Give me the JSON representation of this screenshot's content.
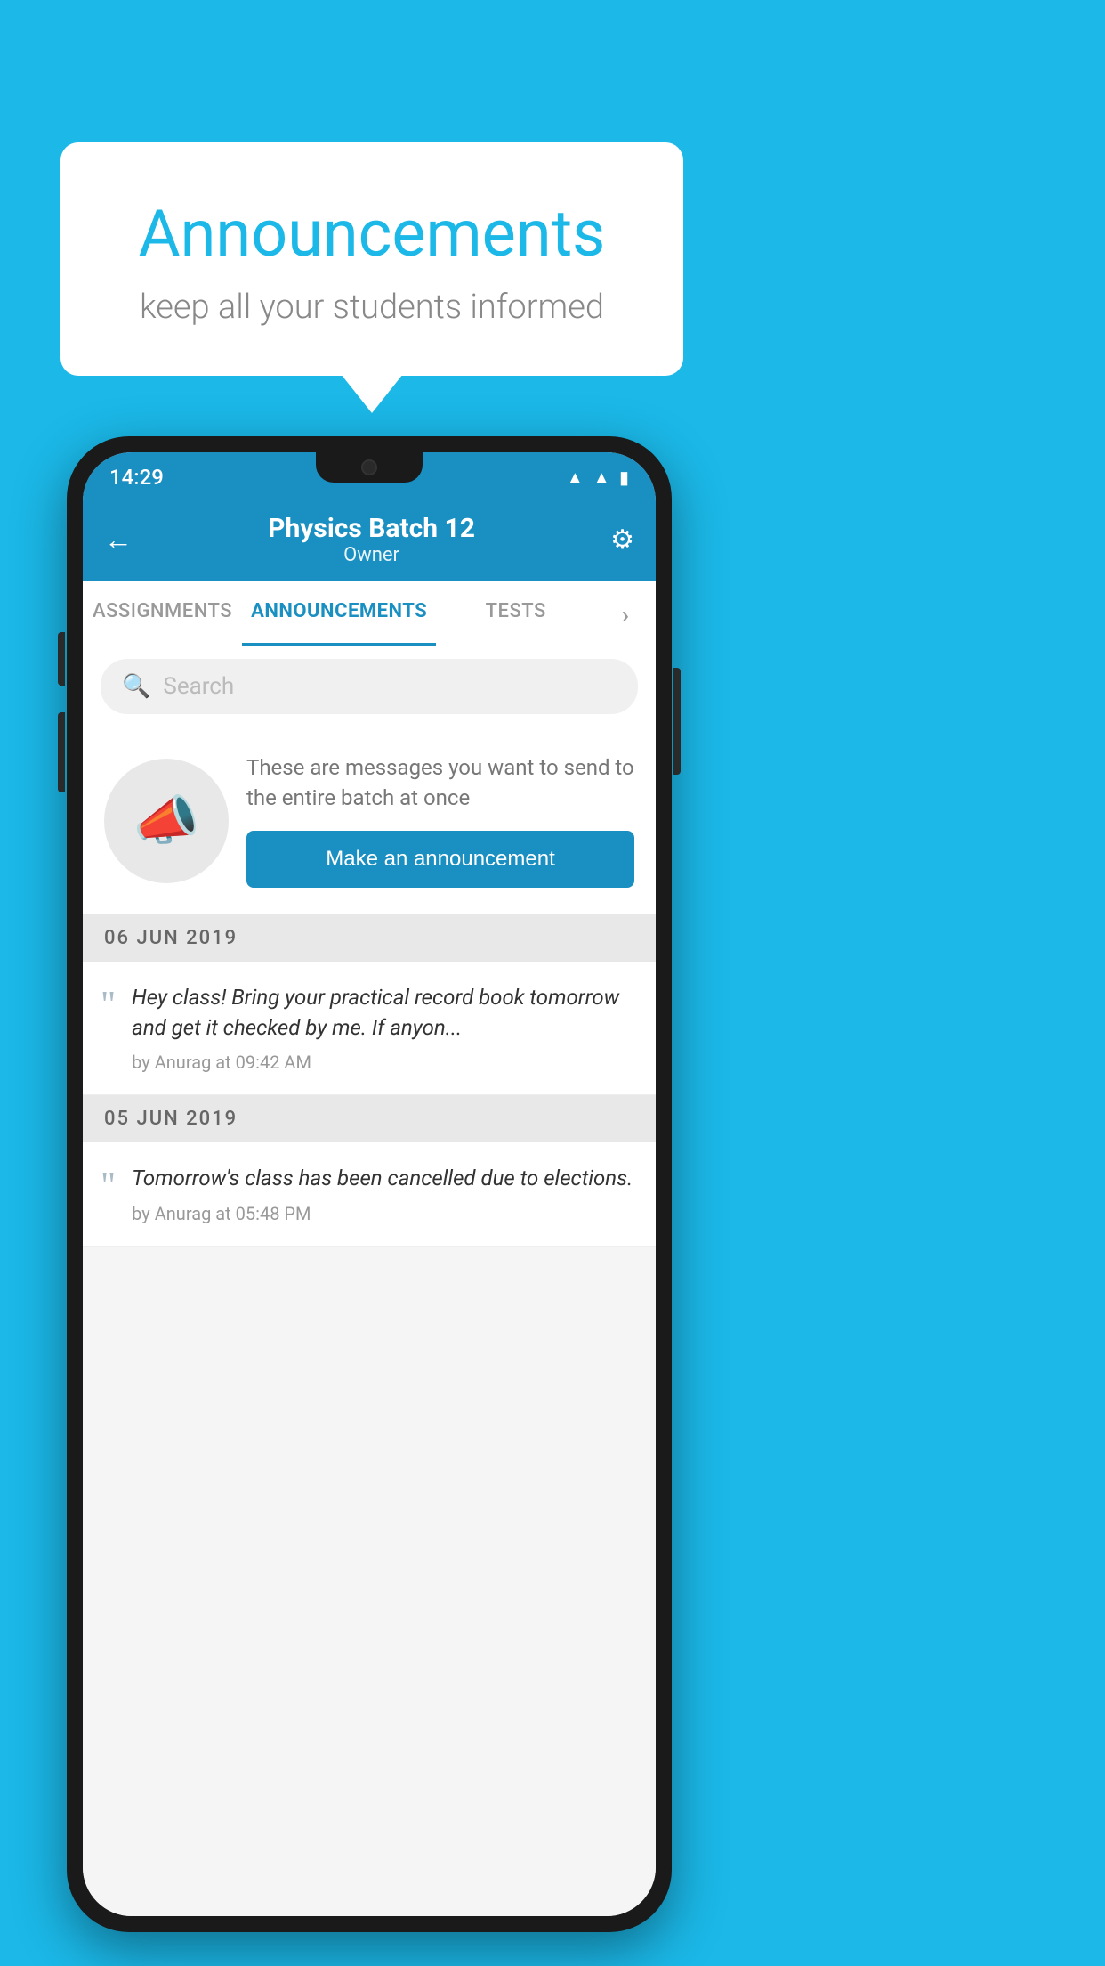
{
  "background_color": "#1BB8E8",
  "bubble": {
    "title": "Announcements",
    "subtitle": "keep all your students informed"
  },
  "phone": {
    "status_bar": {
      "time": "14:29",
      "icons": [
        "wifi",
        "signal",
        "battery"
      ]
    },
    "header": {
      "title": "Physics Batch 12",
      "subtitle": "Owner",
      "back_label": "←",
      "gear_label": "⚙"
    },
    "tabs": [
      {
        "label": "ASSIGNMENTS",
        "active": false
      },
      {
        "label": "ANNOUNCEMENTS",
        "active": true
      },
      {
        "label": "TESTS",
        "active": false
      },
      {
        "label": "›",
        "active": false
      }
    ],
    "search": {
      "placeholder": "Search"
    },
    "announcement_prompt": {
      "description": "These are messages you want to send to the entire batch at once",
      "button_label": "Make an announcement"
    },
    "announcement_dates": [
      {
        "date_label": "06  JUN  2019",
        "items": [
          {
            "text": "Hey class! Bring your practical record book tomorrow and get it checked by me. If anyon...",
            "meta": "by Anurag at 09:42 AM"
          }
        ]
      },
      {
        "date_label": "05  JUN  2019",
        "items": [
          {
            "text": "Tomorrow's class has been cancelled due to elections.",
            "meta": "by Anurag at 05:48 PM"
          }
        ]
      }
    ]
  }
}
